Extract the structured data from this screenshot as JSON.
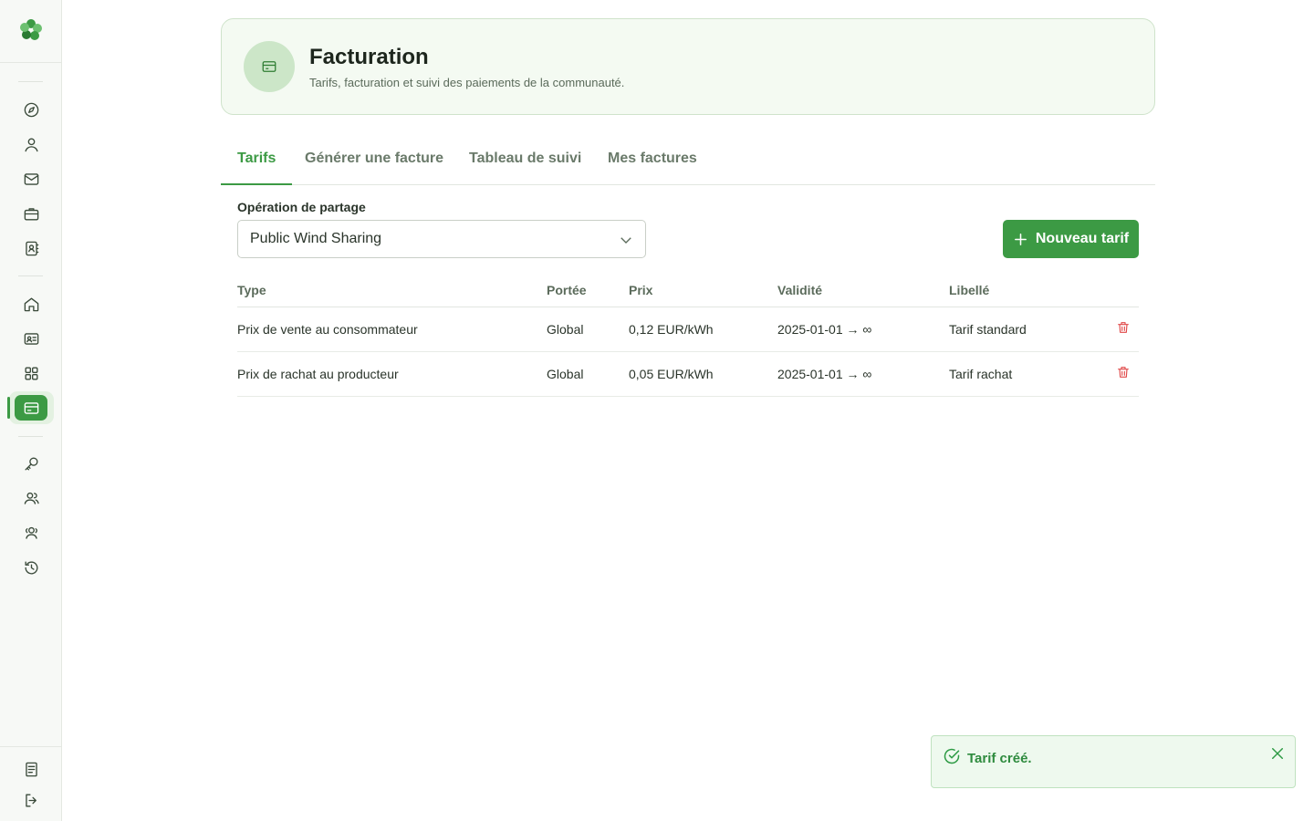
{
  "header": {
    "title": "Facturation",
    "subtitle": "Tarifs, facturation et suivi des paiements de la communauté.",
    "icon": "credit-card-icon"
  },
  "tabs": [
    {
      "label": "Tarifs",
      "active": true
    },
    {
      "label": "Générer une facture",
      "active": false
    },
    {
      "label": "Tableau de suivi",
      "active": false
    },
    {
      "label": "Mes factures",
      "active": false
    }
  ],
  "filter": {
    "label": "Opération de partage",
    "selected": "Public Wind Sharing"
  },
  "actions": {
    "new_tariff": "Nouveau tarif"
  },
  "table": {
    "columns": [
      "Type",
      "Portée",
      "Prix",
      "Validité",
      "Libellé"
    ],
    "rows": [
      {
        "type": "Prix de vente au consommateur",
        "portee": "Global",
        "prix": "0,12 EUR/kWh",
        "validite": "2025-01-01 → ∞",
        "libelle": "Tarif standard"
      },
      {
        "type": "Prix de rachat au producteur",
        "portee": "Global",
        "prix": "0,05 EUR/kWh",
        "validite": "2025-01-01 → ∞",
        "libelle": "Tarif rachat"
      }
    ]
  },
  "toast": {
    "message": "Tarif créé.",
    "status": "success"
  },
  "sidebar": {
    "icons": [
      "compass-icon",
      "user-icon",
      "mail-icon",
      "briefcase-icon",
      "contact-book-icon",
      "home-icon",
      "id-card-icon",
      "grid-icon",
      "credit-card-icon",
      "key-icon",
      "users-icon",
      "users-alt-icon",
      "history-icon",
      "document-icon",
      "logout-icon"
    ],
    "active": "credit-card-icon"
  },
  "colors": {
    "accent": "#3c9a44",
    "danger": "#e04848",
    "header_bg": "#f4faf2",
    "toast_bg": "#eef9ee"
  }
}
